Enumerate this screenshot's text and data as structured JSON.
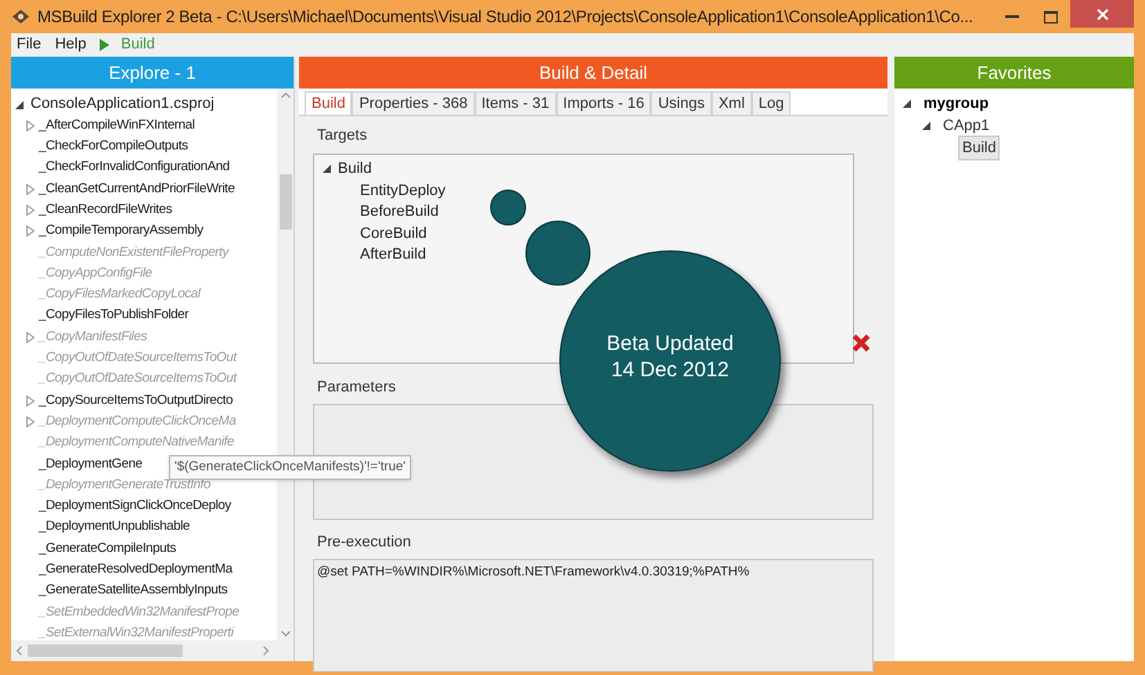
{
  "window": {
    "title": "MSBuild Explorer 2 Beta - C:\\Users\\Michael\\Documents\\Visual Studio 2012\\Projects\\ConsoleApplication1\\ConsoleApplication1\\Co..."
  },
  "menu": [
    {
      "label": "File",
      "kind": "menu"
    },
    {
      "label": "Help",
      "kind": "menu"
    },
    {
      "label": "Build",
      "kind": "run"
    }
  ],
  "explorer": {
    "title": "Explore - 1",
    "root": {
      "label": "ConsoleApplication1.csproj",
      "expanded": true,
      "children": [
        {
          "label": "_AfterCompileWinFXInternal",
          "has_children": true,
          "inherited": false
        },
        {
          "label": "_CheckForCompileOutputs",
          "has_children": false,
          "inherited": false
        },
        {
          "label": "_CheckForInvalidConfigurationAnd",
          "has_children": false,
          "inherited": false
        },
        {
          "label": "_CleanGetCurrentAndPriorFileWrite",
          "has_children": true,
          "inherited": false
        },
        {
          "label": "_CleanRecordFileWrites",
          "has_children": true,
          "inherited": false
        },
        {
          "label": "_CompileTemporaryAssembly",
          "has_children": true,
          "inherited": false
        },
        {
          "label": "_ComputeNonExistentFileProperty",
          "has_children": false,
          "inherited": true
        },
        {
          "label": "_CopyAppConfigFile",
          "has_children": false,
          "inherited": true
        },
        {
          "label": "_CopyFilesMarkedCopyLocal",
          "has_children": false,
          "inherited": true
        },
        {
          "label": "_CopyFilesToPublishFolder",
          "has_children": false,
          "inherited": false
        },
        {
          "label": "_CopyManifestFiles",
          "has_children": true,
          "inherited": true
        },
        {
          "label": "_CopyOutOfDateSourceItemsToOut",
          "has_children": false,
          "inherited": true
        },
        {
          "label": "_CopyOutOfDateSourceItemsToOut",
          "has_children": false,
          "inherited": true
        },
        {
          "label": "_CopySourceItemsToOutputDirecto",
          "has_children": true,
          "inherited": false
        },
        {
          "label": "_DeploymentComputeClickOnceMa",
          "has_children": true,
          "inherited": true
        },
        {
          "label": "_DeploymentComputeNativeManife",
          "has_children": false,
          "inherited": true
        },
        {
          "label": "_DeploymentGene",
          "has_children": false,
          "inherited": false
        },
        {
          "label": "_DeploymentGenerateTrustInfo",
          "has_children": false,
          "inherited": true
        },
        {
          "label": "_DeploymentSignClickOnceDeploy",
          "has_children": false,
          "inherited": false
        },
        {
          "label": "_DeploymentUnpublishable",
          "has_children": false,
          "inherited": false
        },
        {
          "label": "_GenerateCompileInputs",
          "has_children": false,
          "inherited": false
        },
        {
          "label": "_GenerateResolvedDeploymentMa",
          "has_children": false,
          "inherited": false
        },
        {
          "label": "_GenerateSatelliteAssemblyInputs",
          "has_children": false,
          "inherited": false
        },
        {
          "label": "_SetEmbeddedWin32ManifestPrope",
          "has_children": false,
          "inherited": true
        },
        {
          "label": "_SetExternalWin32ManifestProperti",
          "has_children": false,
          "inherited": true
        }
      ]
    }
  },
  "tooltip": {
    "text": "'$(GenerateClickOnceManifests)'!='true'"
  },
  "detail": {
    "title": "Build & Detail",
    "tabs": [
      {
        "label": "Build",
        "selected": true
      },
      {
        "label": "Properties - 368",
        "selected": false
      },
      {
        "label": "Items - 31",
        "selected": false
      },
      {
        "label": "Imports - 16",
        "selected": false
      },
      {
        "label": "Usings",
        "selected": false
      },
      {
        "label": "Xml",
        "selected": false
      },
      {
        "label": "Log",
        "selected": false
      }
    ],
    "targets": {
      "label": "Targets",
      "tree": {
        "label": "Build",
        "expanded": true,
        "children": [
          {
            "label": "EntityDeploy"
          },
          {
            "label": "BeforeBuild"
          },
          {
            "label": "CoreBuild"
          },
          {
            "label": "AfterBuild"
          }
        ]
      }
    },
    "parameters": {
      "label": "Parameters"
    },
    "pre_execution": {
      "label": "Pre-execution",
      "value": "@set PATH=%WINDIR%\\Microsoft.NET\\Framework\\v4.0.30319;%PATH%"
    }
  },
  "announcement": {
    "lines": [
      "Beta Updated",
      "14 Dec 2012"
    ]
  },
  "favorites": {
    "title": "Favorites",
    "tree": [
      {
        "label": "mygroup",
        "kind": "group",
        "expanded": true,
        "children": [
          {
            "label": "CApp1",
            "kind": "project",
            "expanded": true,
            "children": [
              {
                "label": "Build",
                "kind": "target",
                "selected": true
              }
            ]
          }
        ]
      }
    ]
  }
}
